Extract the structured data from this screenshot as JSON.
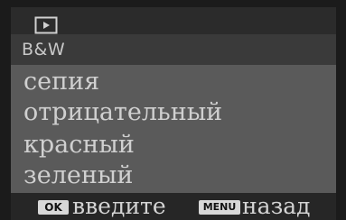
{
  "top_bar": {
    "icon": "play-icon"
  },
  "header": {
    "mode": "B&W"
  },
  "menu": {
    "items": [
      {
        "label": "сепия"
      },
      {
        "label": "отрицательный"
      },
      {
        "label": "красный"
      },
      {
        "label": "зеленый"
      }
    ]
  },
  "footer": {
    "ok_key": "OK",
    "ok_action": "введите",
    "menu_key": "MENU",
    "back_action": "назад"
  }
}
